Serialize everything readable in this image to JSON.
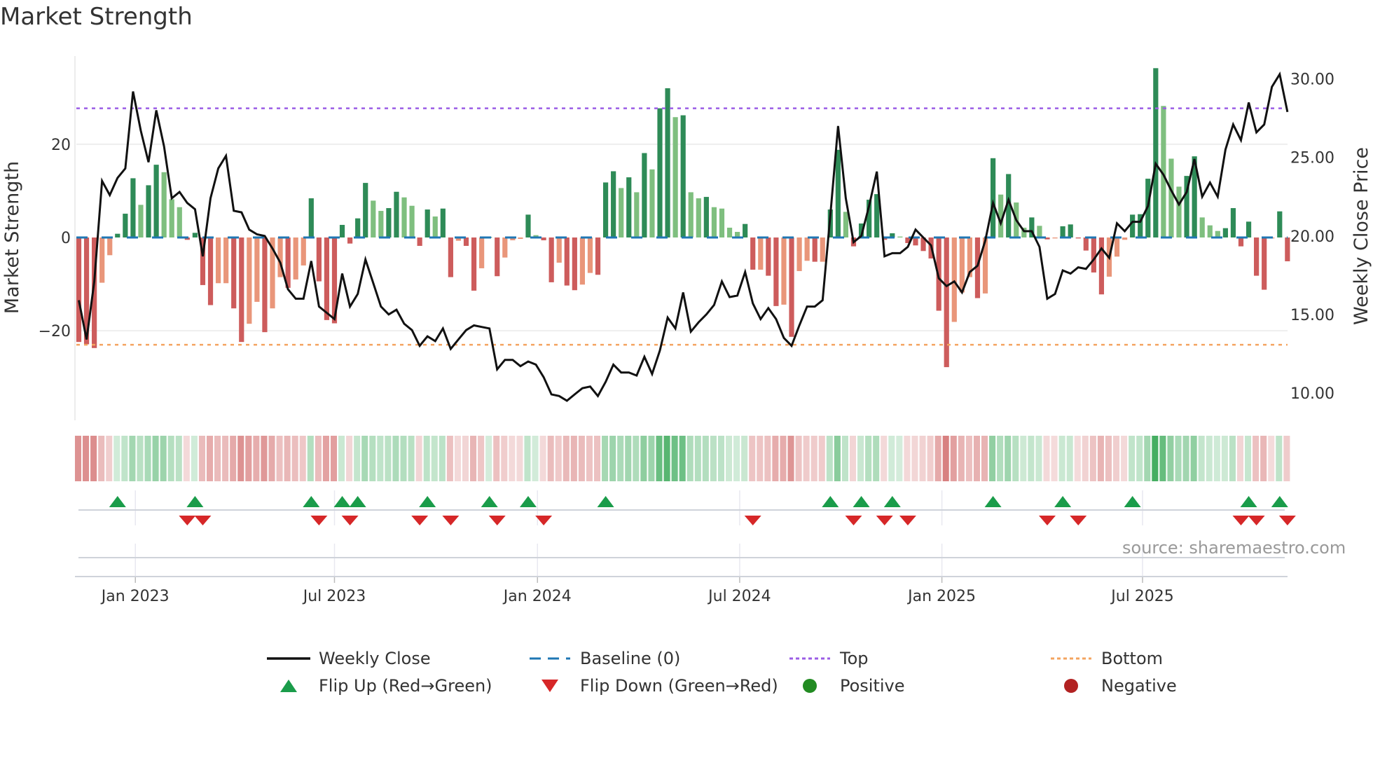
{
  "title": "Market Strength",
  "source": "source: sharemaestro.com",
  "chart_data": {
    "type": "bar",
    "title": "Market Strength",
    "ylabel": "Market Strength",
    "y2label": "Weekly Close Price",
    "x_unit": "week index",
    "ylim": [
      -39.2,
      38.9
    ],
    "y2lim": [
      8.25,
      31.46
    ],
    "yticks": [
      {
        "value": 20,
        "label": "20"
      },
      {
        "value": 0,
        "label": "0"
      },
      {
        "value": -20,
        "label": "−20"
      }
    ],
    "y2ticks": [
      {
        "value": 30,
        "label": "30.00"
      },
      {
        "value": 25,
        "label": "25.00"
      },
      {
        "value": 20,
        "label": "20.00"
      },
      {
        "value": 15,
        "label": "15.00"
      },
      {
        "value": 10,
        "label": "10.00"
      }
    ],
    "xticks": [
      {
        "week": 7.3,
        "label": "Jan 2023"
      },
      {
        "week": 33.0,
        "label": "Jul 2023"
      },
      {
        "week": 59.2,
        "label": "Jan 2024"
      },
      {
        "week": 85.3,
        "label": "Jul 2024"
      },
      {
        "week": 111.4,
        "label": "Jan 2025"
      },
      {
        "week": 137.3,
        "label": "Jul 2025"
      }
    ],
    "top_level": 27.7,
    "bottom_level": -23.0,
    "baseline": 0,
    "grid": true,
    "strength": [
      -22.4,
      -22.9,
      -23.7,
      -9.7,
      -3.8,
      0.8,
      5.1,
      12.7,
      7.0,
      11.2,
      15.6,
      14.0,
      8.2,
      6.5,
      -0.5,
      1.0,
      -10.2,
      -14.5,
      -9.8,
      -9.8,
      -15.2,
      -22.4,
      -18.5,
      -13.8,
      -20.3,
      -15.2,
      -8.5,
      -10.8,
      -9.0,
      -6.0,
      8.4,
      -9.4,
      -17.7,
      -18.4,
      2.7,
      -1.3,
      4.1,
      11.7,
      7.9,
      5.7,
      6.3,
      9.8,
      8.6,
      6.8,
      -1.8,
      6.0,
      4.5,
      6.2,
      -8.5,
      -0.7,
      -1.8,
      -11.4,
      -6.6,
      0.1,
      -8.3,
      -4.3,
      -0.6,
      -0.3,
      4.9,
      0.5,
      -0.6,
      -9.6,
      -5.4,
      -10.3,
      -11.3,
      -10.1,
      -7.6,
      -8.0,
      11.8,
      14.2,
      10.6,
      12.9,
      9.7,
      18.1,
      14.6,
      27.7,
      32.0,
      25.8,
      26.2,
      9.7,
      8.4,
      8.7,
      6.5,
      6.2,
      2.1,
      1.2,
      2.9,
      -6.9,
      -6.9,
      -8.2,
      -14.7,
      -14.4,
      -21.3,
      -7.2,
      -5.0,
      -5.2,
      -5.2,
      6.0,
      18.8,
      5.5,
      -1.9,
      3.0,
      8.1,
      9.3,
      -0.5,
      0.9,
      0.2,
      -1.2,
      -1.7,
      -2.9,
      -4.5,
      -15.7,
      -27.8,
      -18.1,
      -11.8,
      -8.5,
      -13.0,
      -12.0,
      17.0,
      9.2,
      13.6,
      7.5,
      2.1,
      4.3,
      2.5,
      -0.4,
      -0.2,
      2.4,
      2.8,
      -0.2,
      -2.8,
      -7.5,
      -12.2,
      -8.4,
      -4.1,
      -0.5,
      4.9,
      5.0,
      12.6,
      36.3,
      28.2,
      16.9,
      10.9,
      13.2,
      17.4,
      4.3,
      2.6,
      1.4,
      2.0,
      6.3,
      -1.9,
      3.4,
      -8.2,
      -11.2,
      -0.2,
      5.6,
      -5.1
    ],
    "weekly_close": [
      15.9,
      13.4,
      17.1,
      23.5,
      22.6,
      23.7,
      24.3,
      29.2,
      26.7,
      24.7,
      28.0,
      25.7,
      22.4,
      22.8,
      22.1,
      21.7,
      18.7,
      22.4,
      24.3,
      25.1,
      21.6,
      21.5,
      20.4,
      20.1,
      20.0,
      19.2,
      18.3,
      16.6,
      16.0,
      16.0,
      18.4,
      15.5,
      15.1,
      14.7,
      17.6,
      15.5,
      16.3,
      18.5,
      17.0,
      15.5,
      15.0,
      15.3,
      14.4,
      14.0,
      13.0,
      13.6,
      13.3,
      14.1,
      12.8,
      13.4,
      14.0,
      14.3,
      14.2,
      14.1,
      11.5,
      12.1,
      12.1,
      11.7,
      12.0,
      11.8,
      11.0,
      9.9,
      9.8,
      9.5,
      9.9,
      10.3,
      10.4,
      9.8,
      10.7,
      11.8,
      11.3,
      11.3,
      11.1,
      12.3,
      11.2,
      12.7,
      14.8,
      14.1,
      16.4,
      13.9,
      14.5,
      15.0,
      15.6,
      17.1,
      16.1,
      16.2,
      17.7,
      15.7,
      14.7,
      15.4,
      14.7,
      13.5,
      13.0,
      14.3,
      15.5,
      15.5,
      15.9,
      21.3,
      27.0,
      22.4,
      19.6,
      20.0,
      21.9,
      24.1,
      18.7,
      18.9,
      18.9,
      19.3,
      20.4,
      19.9,
      19.4,
      17.3,
      16.8,
      17.1,
      16.4,
      17.7,
      18.1,
      19.7,
      22.1,
      20.8,
      22.3,
      21.0,
      20.3,
      20.3,
      19.3,
      16.0,
      16.3,
      17.8,
      17.6,
      18.0,
      17.9,
      18.5,
      19.2,
      18.6,
      20.8,
      20.3,
      20.9,
      20.9,
      21.9,
      24.6,
      23.9,
      22.9,
      22.0,
      22.8,
      24.9,
      22.5,
      23.4,
      22.5,
      25.5,
      27.1,
      26.1,
      28.5,
      26.6,
      27.1,
      29.5,
      30.3,
      27.9
    ],
    "legend": [
      {
        "key": "close",
        "label": "Weekly Close"
      },
      {
        "key": "baseline",
        "label": "Baseline (0)"
      },
      {
        "key": "top",
        "label": "Top"
      },
      {
        "key": "bottom",
        "label": "Bottom"
      },
      {
        "key": "flip_up",
        "label": "Flip Up (Red→Green)"
      },
      {
        "key": "flip_down",
        "label": "Flip Down (Green→Red)"
      },
      {
        "key": "positive",
        "label": "Positive"
      },
      {
        "key": "negative",
        "label": "Negative"
      }
    ],
    "legend_position": "bottom",
    "colors": {
      "pos_strong": "#2e8b57",
      "pos_weak": "#7fbf7f",
      "neg_strong": "#cd5c5c",
      "neg_weak": "#e9967a",
      "close": "#111111",
      "baseline": "#1f77b4",
      "top": "#9b5de5",
      "bottom": "#f4a460",
      "flip_up": "#1a9c4a",
      "flip_down": "#d62728",
      "positive": "#228b22",
      "negative": "#b22222"
    }
  }
}
